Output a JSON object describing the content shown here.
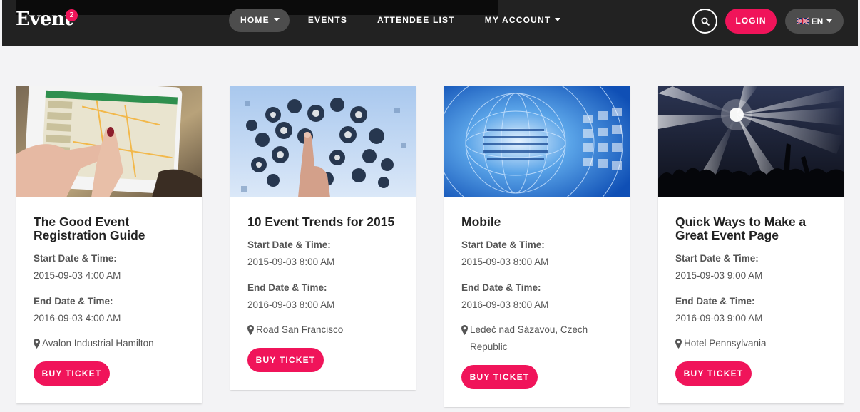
{
  "brand": {
    "logo_text": "Event",
    "badge_count": "2"
  },
  "nav": {
    "items": [
      {
        "label": "HOME",
        "has_dropdown": true,
        "active": true
      },
      {
        "label": "EVENTS",
        "has_dropdown": false
      },
      {
        "label": "ATTENDEE LIST",
        "has_dropdown": false
      },
      {
        "label": "MY ACCOUNT",
        "has_dropdown": true
      }
    ]
  },
  "header_actions": {
    "search_icon": "search-icon",
    "login_label": "LOGIN",
    "language_label": "EN",
    "language_flag": "uk-flag-icon"
  },
  "labels": {
    "start": "Start Date & Time:",
    "end": "End Date & Time:",
    "buy": "BUY TICKET"
  },
  "events": [
    {
      "title": "The Good Event Registration Guide",
      "start": "2015-09-03 4:00 AM",
      "end": "2016-09-03 4:00 AM",
      "location": "Avalon Industrial Hamilton",
      "image": "tablet-map-photo"
    },
    {
      "title": "10 Event Trends for 2015",
      "start": "2015-09-03 8:00 AM",
      "end": "2016-09-03 8:00 AM",
      "location": "Road San Francisco",
      "image": "social-media-icons-photo"
    },
    {
      "title": "Mobile",
      "start": "2015-09-03 8:00 AM",
      "end": "2016-09-03 8:00 AM",
      "location": "Ledeč nad Sázavou, Czech Republic",
      "image": "binary-globe-photo"
    },
    {
      "title": "Quick Ways to Make a Great Event Page",
      "start": "2015-09-03 9:00 AM",
      "end": "2016-09-03 9:00 AM",
      "location": "Hotel Pennsylvania",
      "image": "concert-crowd-photo"
    }
  ],
  "colors": {
    "accent": "#f0145a",
    "header_bg": "#222222",
    "page_bg": "#f3f3f5"
  }
}
